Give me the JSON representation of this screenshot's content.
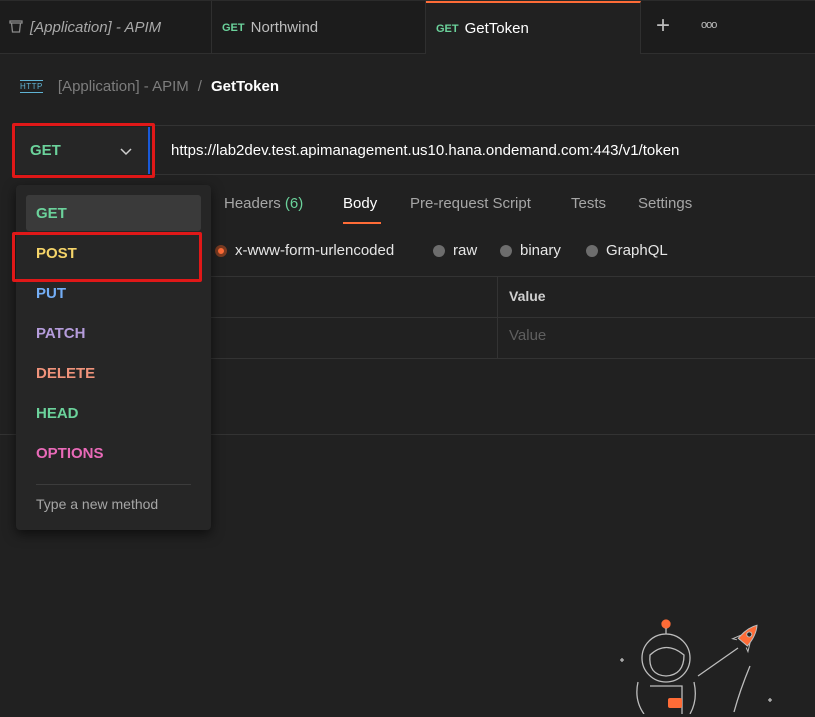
{
  "tabs": [
    {
      "method": "",
      "title": "[Application] - APIM",
      "style": "italic"
    },
    {
      "method": "GET",
      "title": "Northwind"
    },
    {
      "method": "GET",
      "title": "GetToken",
      "active": true
    }
  ],
  "tab_actions": {
    "add": "+",
    "more": "ooo"
  },
  "breadcrumb": {
    "icon_text": "HTTP",
    "parent": "[Application] - APIM",
    "separator": "/",
    "current": "GetToken"
  },
  "request": {
    "method": "GET",
    "url": "https://lab2dev.test.apimanagement.us10.hana.ondemand.com:443/v1/token"
  },
  "subtabs": {
    "headers_label": "Headers",
    "headers_count": "(6)",
    "body": "Body",
    "prerequest": "Pre-request Script",
    "tests": "Tests",
    "settings": "Settings"
  },
  "body_types": {
    "urlencoded": "x-www-form-urlencoded",
    "raw": "raw",
    "binary": "binary",
    "graphql": "GraphQL"
  },
  "table": {
    "value_header": "Value",
    "value_placeholder": "Value"
  },
  "method_menu": {
    "options": [
      {
        "label": "GET",
        "color": "#6bd29b"
      },
      {
        "label": "POST",
        "color": "#f5d469"
      },
      {
        "label": "PUT",
        "color": "#74aef6"
      },
      {
        "label": "PATCH",
        "color": "#b59cdb"
      },
      {
        "label": "DELETE",
        "color": "#f0937b"
      },
      {
        "label": "HEAD",
        "color": "#6bd29b"
      },
      {
        "label": "OPTIONS",
        "color": "#e96ab8"
      }
    ],
    "new_method": "Type a new method"
  },
  "colors": {
    "accent": "#ff6c37",
    "highlight_box": "#e01818",
    "focus": "#1a5ad8"
  }
}
